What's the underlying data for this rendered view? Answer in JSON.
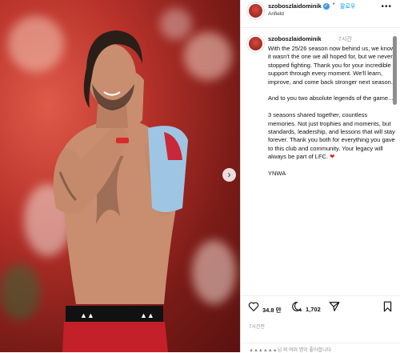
{
  "post": {
    "username": "szoboszlaidominik",
    "follow_label": "팔로우",
    "location": "Anfield",
    "time_ago": "7시간",
    "caption_paragraphs": [
      "With the 25/26 season now behind us, we know it wasn't the one we all hoped for, but we never stopped fighting. Thank you for your incredible support through every moment. We'll learn, improve, and come back stronger next season.",
      "And to you two absolute legends of the game...",
      "3 seasons shared together, countless memories. Not just trophies and moments, but standards, leadership, and lessons that will stay forever. Thank you both for everything you gave to this club and community. Your legacy will always be part of LFC.",
      "YNWA"
    ],
    "heart_emoji": "❤",
    "likes": "34.8 만",
    "comments": "1,702",
    "date": "7시간전",
    "comment_placeholder": "▲▲▲▲▲▲님 외 여러 명이 좋아합니다"
  },
  "icons": {
    "more": "more-horizontal-icon",
    "like": "heart-outline-icon",
    "comment": "comment-bubble-icon",
    "share": "paper-plane-icon",
    "save": "bookmark-icon",
    "next": "chevron-right-icon",
    "verified": "verified-badge-icon"
  },
  "colors": {
    "accent": "#0095f6",
    "verified": "#3897f0",
    "background_red": "#b8322a"
  }
}
